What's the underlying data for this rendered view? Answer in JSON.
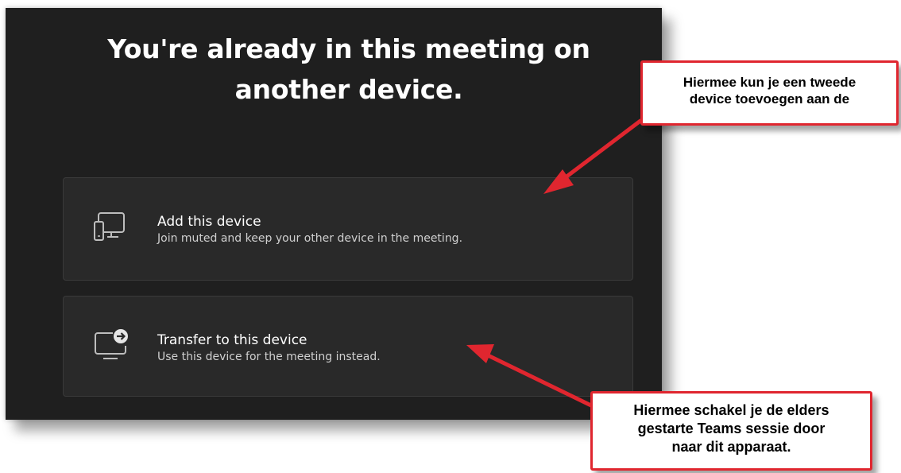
{
  "dialog": {
    "title_line1": "You're already in this meeting on",
    "title_line2": "another device."
  },
  "options": [
    {
      "label": "Add this device",
      "description": "Join muted and keep your other device in the meeting.",
      "icon": "phone-and-monitor-icon"
    },
    {
      "label": "Transfer to this device",
      "description": "Use this device for the meeting instead.",
      "icon": "monitor-transfer-icon"
    }
  ],
  "callouts": {
    "top_line1": "Hiermee kun je een tweede",
    "top_line2": "device toevoegen aan de",
    "bottom_line1": "Hiermee schakel je de elders",
    "bottom_line2": "gestarte Teams sessie door",
    "bottom_line3": "naar dit apparaat."
  },
  "colors": {
    "dialog_background": "#1f1f1f",
    "option_background": "#292929",
    "callout_border": "#e0262f",
    "arrow": "#e0262f"
  }
}
